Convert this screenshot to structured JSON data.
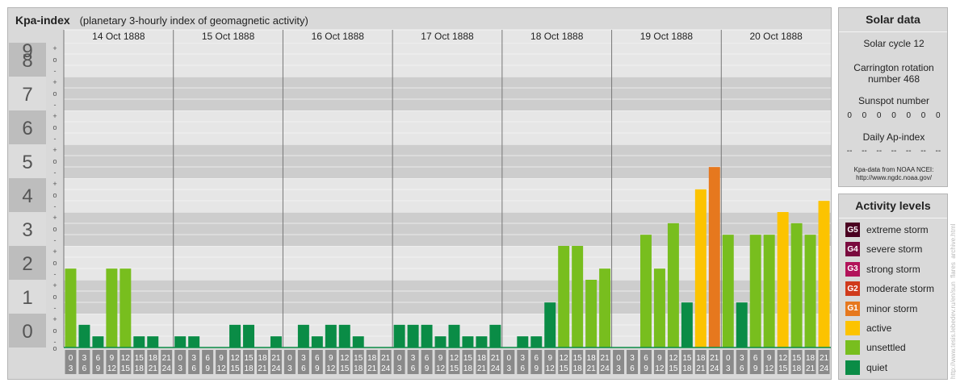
{
  "chart_title": "Kpa-index",
  "chart_subtitle": "(planetary 3-hourly index of geomagnetic activity)",
  "chart_data": {
    "type": "bar",
    "title": "Kpa-index",
    "subtitle": "(planetary 3-hourly index of geomagnetic activity)",
    "ylim": [
      0,
      9
    ],
    "y_ticks": [
      "0",
      "1",
      "2",
      "3",
      "4",
      "5",
      "6",
      "7",
      "8",
      "9"
    ],
    "sub_ticks": [
      "-",
      "o",
      "+"
    ],
    "days": [
      "14 Oct 1888",
      "15 Oct 1888",
      "16 Oct 1888",
      "17 Oct 1888",
      "18 Oct 1888",
      "19 Oct 1888",
      "20 Oct 1888"
    ],
    "time_starts": [
      "0",
      "3",
      "6",
      "9",
      "12",
      "15",
      "18",
      "21"
    ],
    "time_ends": [
      "3",
      "6",
      "9",
      "12",
      "15",
      "18",
      "21",
      "24"
    ],
    "values": [
      2.33,
      0.67,
      0.33,
      2.33,
      2.33,
      0.33,
      0.33,
      0,
      0.33,
      0.33,
      0,
      0,
      0.67,
      0.67,
      0,
      0.33,
      0,
      0.67,
      0.33,
      0.67,
      0.67,
      0.33,
      0,
      0,
      0.67,
      0.67,
      0.67,
      0.33,
      0.67,
      0.33,
      0.33,
      0.67,
      0,
      0.33,
      0.33,
      1.33,
      3,
      3,
      2,
      2.33,
      0,
      0,
      3.33,
      2.33,
      3.67,
      1.33,
      4.67,
      5.33,
      3.33,
      1.33,
      3.33,
      3.33,
      4,
      3.67,
      3.33,
      4.33
    ],
    "grid": true,
    "legend": "right"
  },
  "solar": {
    "title": "Solar data",
    "cycle": "Solar cycle 12",
    "carrington_1": "Carrington rotation",
    "carrington_2": "number 468",
    "sunspot_label": "Sunspot number",
    "sunspot_values": [
      "0",
      "0",
      "0",
      "0",
      "0",
      "0",
      "0"
    ],
    "ap_label": "Daily Ap-index",
    "ap_values": [
      "--",
      "--",
      "--",
      "--",
      "--",
      "--",
      "--"
    ],
    "source_1": "Kpa-data from NOAA NCEI:",
    "source_2": "http://www.ngdc.noaa.gov/"
  },
  "levels": {
    "title": "Activity levels",
    "items": [
      {
        "badge": "G5",
        "label": "extreme storm",
        "color": "#4b0021"
      },
      {
        "badge": "G4",
        "label": "severe storm",
        "color": "#7a0a3e"
      },
      {
        "badge": "G3",
        "label": "strong storm",
        "color": "#b2135a"
      },
      {
        "badge": "G2",
        "label": "moderate storm",
        "color": "#d03a1b"
      },
      {
        "badge": "G1",
        "label": "minor storm",
        "color": "#e6781e"
      },
      {
        "badge": "",
        "label": "active",
        "color": "#fcc300"
      },
      {
        "badge": "",
        "label": "unsettled",
        "color": "#78be1e"
      },
      {
        "badge": "",
        "label": "quiet",
        "color": "#0a8c46"
      }
    ]
  },
  "colors": {
    "quiet": "#0a8c46",
    "unsettled": "#78be1e",
    "active": "#fcc300",
    "minor_storm": "#e6781e"
  },
  "watermark": "http://www.tesis.lebedev.ru/en/sun_flares_archive.html"
}
